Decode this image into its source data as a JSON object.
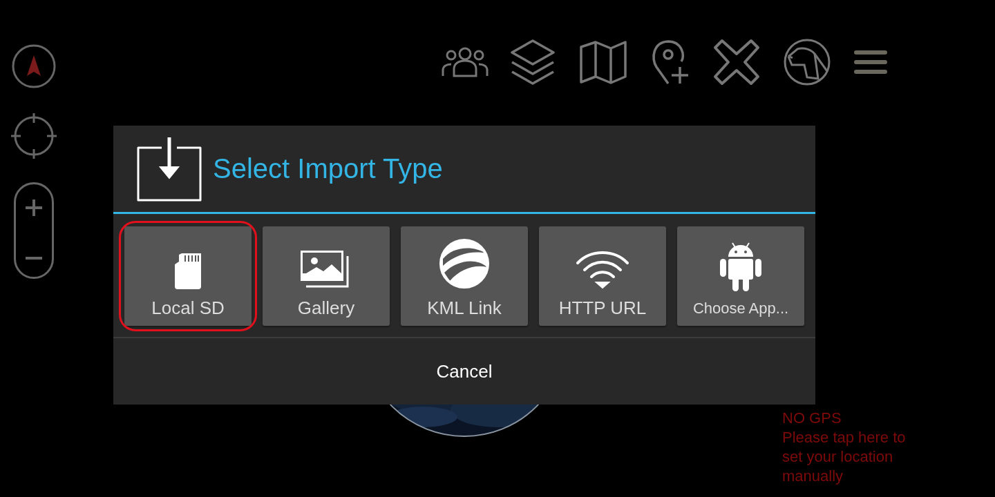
{
  "dialog": {
    "title": "Select Import Type",
    "options": [
      {
        "label": "Local SD",
        "kind": "sd",
        "selected": true
      },
      {
        "label": "Gallery",
        "kind": "gallery",
        "selected": false
      },
      {
        "label": "KML Link",
        "kind": "globe",
        "selected": false
      },
      {
        "label": "HTTP URL",
        "kind": "wifi",
        "selected": false
      },
      {
        "label": "Choose App...",
        "kind": "android",
        "selected": false
      }
    ],
    "cancel": "Cancel"
  },
  "gps_notice": {
    "title": "NO GPS",
    "message": "Please tap here to set your location manually"
  }
}
